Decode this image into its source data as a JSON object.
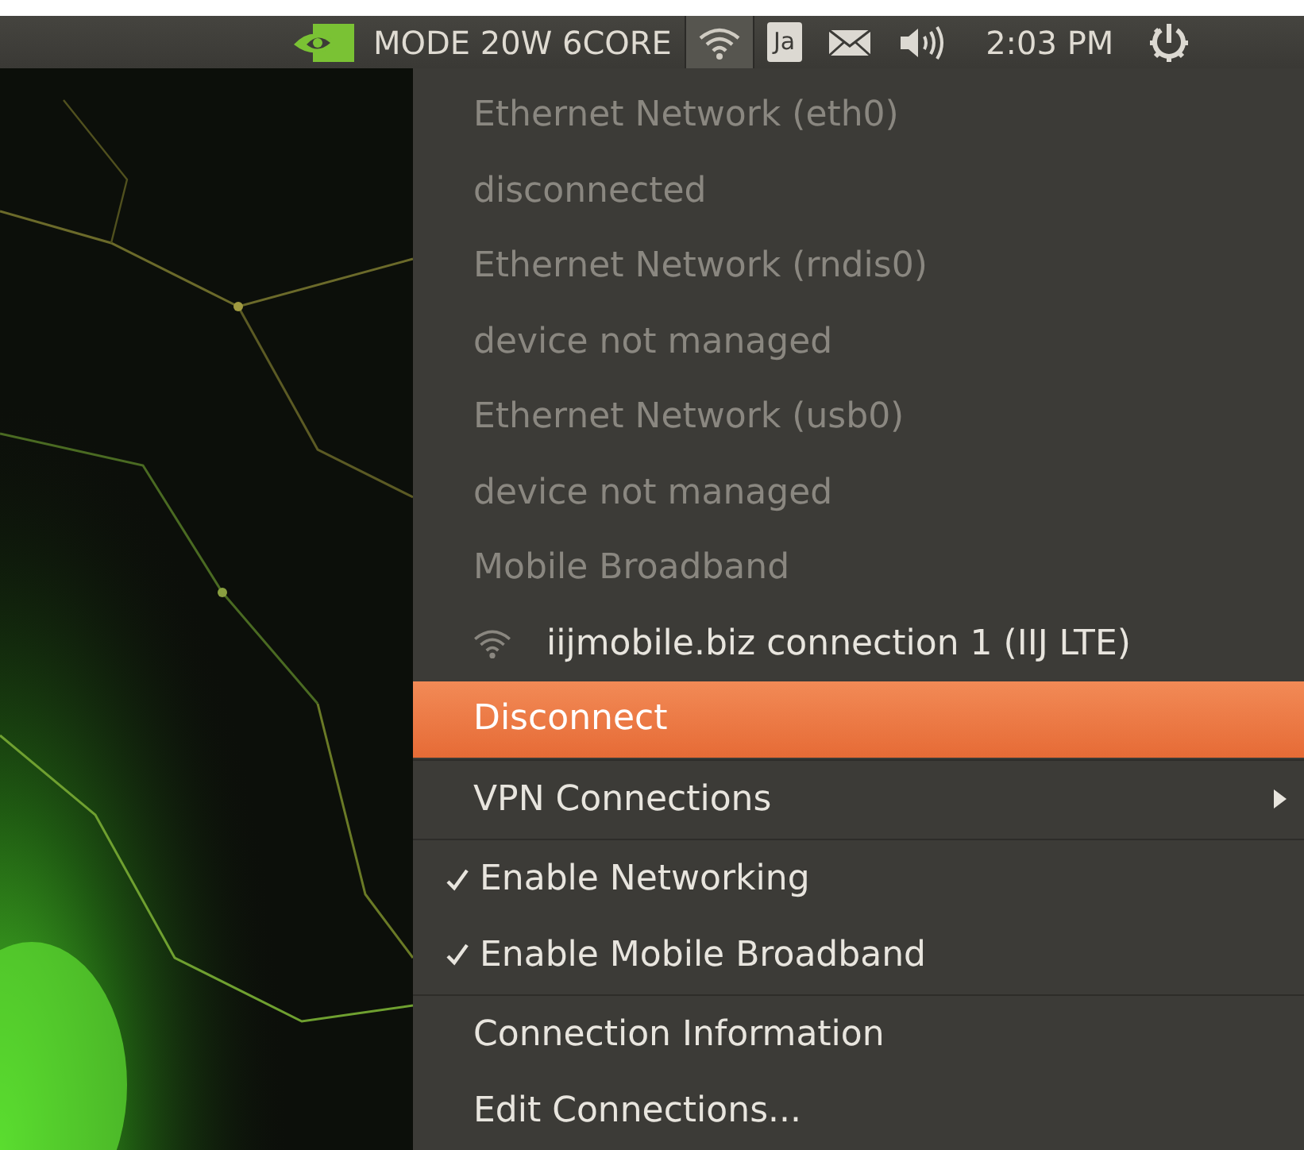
{
  "panel": {
    "mode_label": "MODE 20W 6CORE",
    "network_selected": true,
    "keyboard": "Ja",
    "clock": "2:03 PM"
  },
  "menu": {
    "items": [
      {
        "kind": "header",
        "label": "Ethernet Network (eth0)",
        "disabled": true
      },
      {
        "kind": "status",
        "label": "disconnected",
        "disabled": true
      },
      {
        "kind": "header",
        "label": "Ethernet Network (rndis0)",
        "disabled": true
      },
      {
        "kind": "status",
        "label": "device not managed",
        "disabled": true
      },
      {
        "kind": "header",
        "label": "Ethernet Network (usb0)",
        "disabled": true
      },
      {
        "kind": "status",
        "label": "device not managed",
        "disabled": true
      },
      {
        "kind": "header",
        "label": "Mobile Broadband",
        "disabled": true
      },
      {
        "kind": "network",
        "label": "iijmobile.biz connection 1 (IIJ LTE)",
        "disabled": false
      },
      {
        "kind": "action",
        "label": "Disconnect",
        "selected": true
      },
      {
        "kind": "separator"
      },
      {
        "kind": "submenu",
        "label": "VPN Connections",
        "selected": false
      },
      {
        "kind": "separator"
      },
      {
        "kind": "check",
        "label": "Enable Networking",
        "checked": true
      },
      {
        "kind": "check",
        "label": "Enable Mobile Broadband",
        "checked": true
      },
      {
        "kind": "separator"
      },
      {
        "kind": "action",
        "label": "Connection Information",
        "selected": false
      },
      {
        "kind": "action",
        "label": "Edit Connections...",
        "selected": false
      }
    ]
  }
}
